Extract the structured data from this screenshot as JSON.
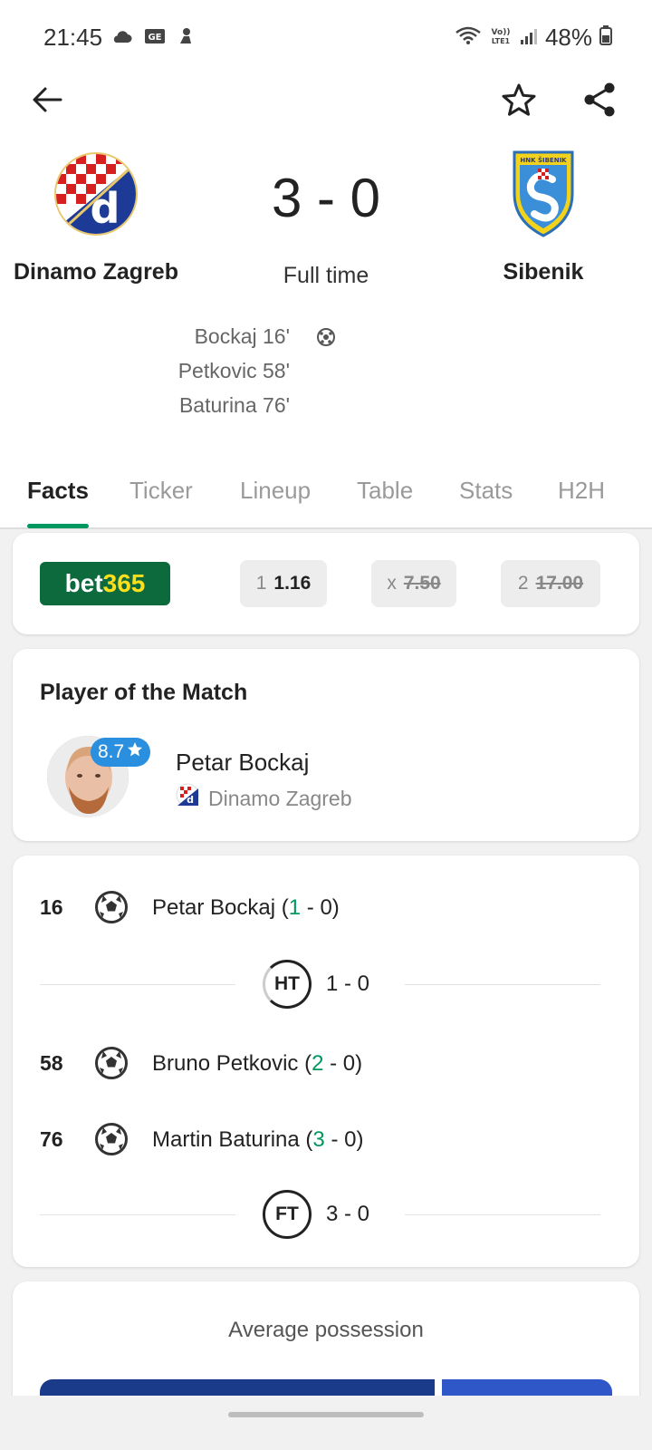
{
  "status_bar": {
    "time": "21:45",
    "battery": "48%",
    "icons_left": [
      "cloud-icon",
      "ge-icon",
      "notification-icon"
    ],
    "icons_right": [
      "wifi-icon",
      "volte-icon",
      "signal-icon",
      "battery-icon"
    ]
  },
  "app_bar": {
    "back_icon": "arrow-left-icon",
    "favorite_icon": "star-outline-icon",
    "share_icon": "share-icon"
  },
  "match": {
    "home_team": "Dinamo Zagreb",
    "away_team": "Sibenik",
    "score": "3 - 0",
    "status": "Full time",
    "home_scorers": [
      "Bockaj 16'",
      "Petkovic 58'",
      "Baturina 76'"
    ]
  },
  "tabs": [
    {
      "label": "Facts",
      "active": true
    },
    {
      "label": "Ticker",
      "active": false
    },
    {
      "label": "Lineup",
      "active": false
    },
    {
      "label": "Table",
      "active": false
    },
    {
      "label": "Stats",
      "active": false
    },
    {
      "label": "H2H",
      "active": false
    }
  ],
  "odds": {
    "provider_part1": "bet",
    "provider_part2": "365",
    "home": {
      "label": "1",
      "value": "1.16"
    },
    "draw": {
      "label": "x",
      "value": "7.50"
    },
    "away": {
      "label": "2",
      "value": "17.00"
    }
  },
  "player_of_match": {
    "title": "Player of the Match",
    "name": "Petar Bockaj",
    "team": "Dinamo Zagreb",
    "rating": "8.7"
  },
  "events": [
    {
      "minute": "16",
      "player": "Petar Bockaj",
      "score_home": "1",
      "score_away": "0"
    },
    {
      "minute": "58",
      "player": "Bruno Petkovic",
      "score_home": "2",
      "score_away": "0"
    },
    {
      "minute": "76",
      "player": "Martin Baturina",
      "score_home": "3",
      "score_away": "0"
    }
  ],
  "periods": {
    "half_time": {
      "label": "HT",
      "score": "1 - 0"
    },
    "full_time": {
      "label": "FT",
      "score": "3 - 0"
    }
  },
  "possession": {
    "title": "Average possession"
  },
  "colors": {
    "accent_green": "#00985f",
    "bet365_green": "#0d6a3d",
    "bet365_yellow": "#ffdf1b",
    "rating_blue": "#2b8fe0",
    "possession_home": "#1a3a8a",
    "possession_away": "#2f57c8"
  }
}
